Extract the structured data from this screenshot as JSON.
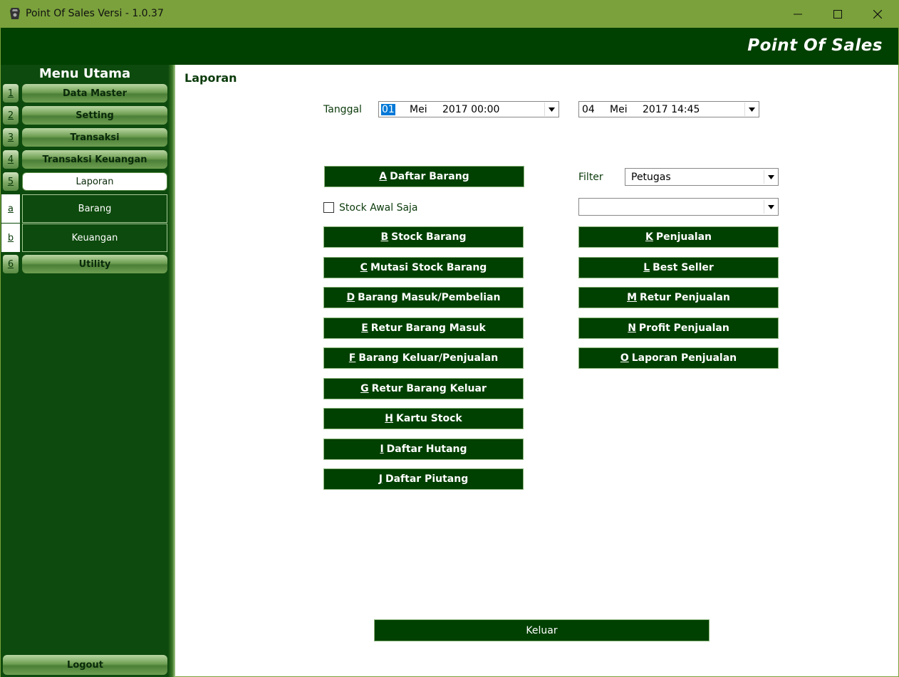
{
  "window": {
    "title": "Point Of Sales Versi - 1.0.37",
    "brand": "Point Of Sales"
  },
  "sidebar": {
    "menu_title": "Menu Utama",
    "items": [
      {
        "num": "1",
        "label": "Data Master"
      },
      {
        "num": "2",
        "label": "Setting"
      },
      {
        "num": "3",
        "label": "Transaksi"
      },
      {
        "num": "4",
        "label": "Transaksi Keuangan"
      },
      {
        "num": "5",
        "label": "Laporan"
      },
      {
        "num": "6",
        "label": "Utility"
      }
    ],
    "subitems": [
      {
        "key": "a",
        "label": "Barang"
      },
      {
        "key": "b",
        "label": "Keuangan"
      }
    ],
    "logout": "Logout"
  },
  "content": {
    "title": "Laporan",
    "tanggal_label": "Tanggal",
    "date_from": {
      "day": "01",
      "month": "Mei",
      "rest": "2017 00:00"
    },
    "date_to": {
      "day": "04",
      "month": "Mei",
      "rest": "2017 14:45"
    },
    "filter_label": "Filter",
    "filter_value": "Petugas",
    "filter2_value": "",
    "stock_awal_label": "Stock Awal Saja",
    "left_buttons": [
      {
        "key": "A",
        "label": "Daftar Barang"
      },
      {
        "key": "B",
        "label": "Stock Barang"
      },
      {
        "key": "C",
        "label": "Mutasi Stock Barang"
      },
      {
        "key": "D",
        "label": "Barang Masuk/Pembelian"
      },
      {
        "key": "E",
        "label": "Retur Barang Masuk"
      },
      {
        "key": "F",
        "label": "Barang Keluar/Penjualan"
      },
      {
        "key": "G",
        "label": "Retur Barang Keluar"
      },
      {
        "key": "H",
        "label": "Kartu Stock"
      },
      {
        "key": "I",
        "label": "Daftar Hutang"
      },
      {
        "key": "J",
        "label": "Daftar Piutang"
      }
    ],
    "right_buttons": [
      {
        "key": "K",
        "label": "Penjualan"
      },
      {
        "key": "L",
        "label": "Best Seller"
      },
      {
        "key": "M",
        "label": "Retur Penjualan"
      },
      {
        "key": "N",
        "label": "Profit Penjualan"
      },
      {
        "key": "O",
        "label": "Laporan Penjualan"
      }
    ],
    "keluar": "Keluar"
  },
  "colors": {
    "titlebar": "#7aa13b",
    "header": "#004000",
    "button": "#004000",
    "selection": "#0078d7"
  }
}
